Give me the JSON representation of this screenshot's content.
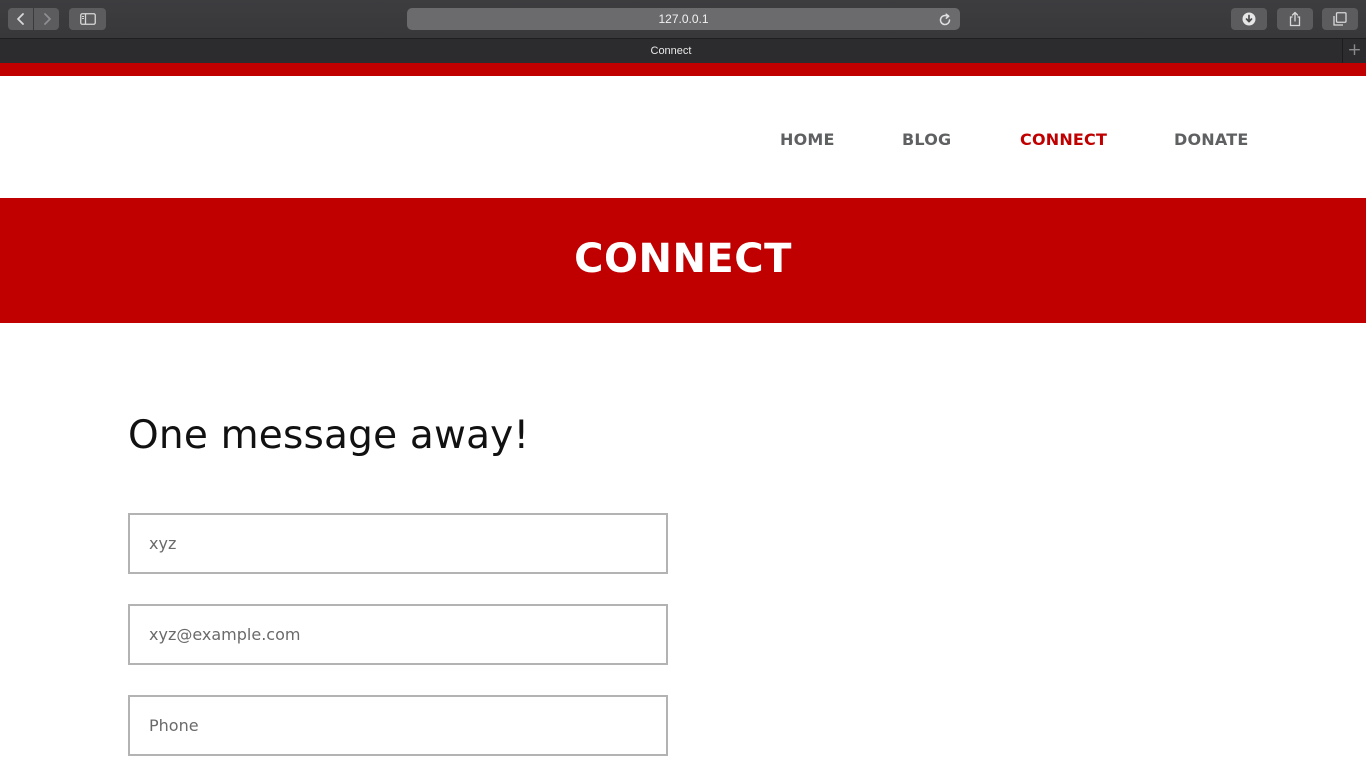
{
  "browser": {
    "url": "127.0.0.1",
    "tab_title": "Connect",
    "new_tab_label": "+",
    "icons": {
      "back": "chevron-left-icon",
      "forward": "chevron-right-icon",
      "sidebar": "sidebar-icon",
      "reload": "reload-icon",
      "downloads": "download-icon",
      "share": "share-icon",
      "tabs": "tab-overview-icon"
    }
  },
  "colors": {
    "brand": "#c00000",
    "nav_text": "#5f6062",
    "nav_active": "#c00000"
  },
  "nav": {
    "items": [
      {
        "label": "HOME",
        "active": false
      },
      {
        "label": "BLOG",
        "active": false
      },
      {
        "label": "CONNECT",
        "active": true
      },
      {
        "label": "DONATE",
        "active": false
      }
    ]
  },
  "banner": {
    "title": "CONNECT"
  },
  "form": {
    "heading": "One message away!",
    "name_placeholder": "xyz",
    "email_placeholder": "xyz@example.com",
    "phone_placeholder": "Phone"
  }
}
